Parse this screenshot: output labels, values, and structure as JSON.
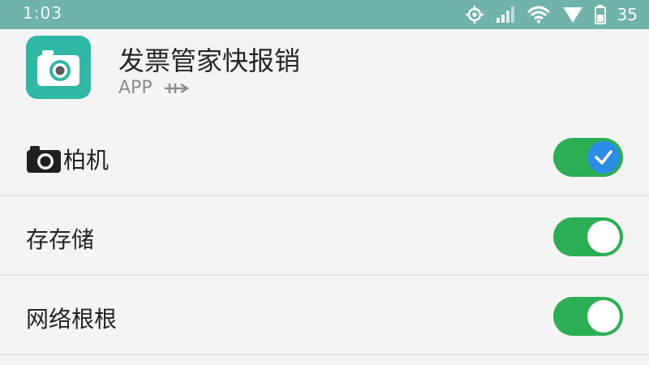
{
  "status_bar": {
    "time": "1:03",
    "battery_text": "35",
    "icons": [
      "location-icon",
      "signal-icon",
      "wifi-icon",
      "signal-triangle-icon",
      "battery-icon"
    ]
  },
  "app": {
    "title": "发票管家快报销",
    "subtitle": "APP",
    "icon": "camera-icon",
    "icon_color": "#2fb8a5"
  },
  "permissions": [
    {
      "label": "柏机",
      "enabled": true,
      "icon": "camera-icon",
      "knob_state": "checked"
    },
    {
      "label": "存存储",
      "enabled": true
    },
    {
      "label": "网络根根",
      "enabled": true
    }
  ],
  "colors": {
    "status_bar": "#6fb3aa",
    "toggle_on": "#2cae55",
    "check_knob": "#2d8de6"
  }
}
